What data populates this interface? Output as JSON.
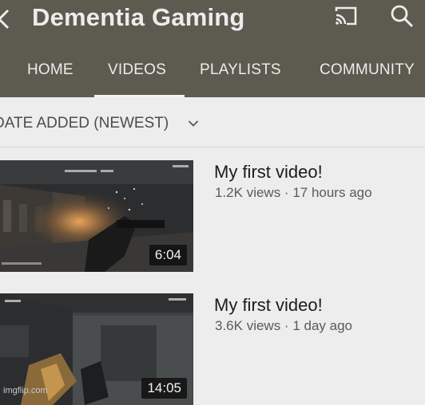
{
  "header": {
    "title": "Dementia Gaming",
    "icons": [
      "back-arrow-icon",
      "cast-icon",
      "search-icon"
    ]
  },
  "tabs": [
    {
      "label": "HOME",
      "selected": false
    },
    {
      "label": "VIDEOS",
      "selected": true
    },
    {
      "label": "PLAYLISTS",
      "selected": false
    },
    {
      "label": "COMMUNITY",
      "selected": false
    }
  ],
  "sort": {
    "label": "DATE ADDED (NEWEST)",
    "icon": "chevron-down-icon"
  },
  "videos": [
    {
      "title": "My first video!",
      "views": "1.2K views",
      "separator": " · ",
      "age": "17 hours ago",
      "duration": "6:04"
    },
    {
      "title": "My first video!",
      "views": "3.6K views",
      "separator": " · ",
      "age": "1 day ago",
      "duration": "14:05"
    }
  ],
  "watermark": "imgflip.com",
  "colors": {
    "header_bg": "#5d5a4f",
    "header_text": "#ececec",
    "page_bg": "#ededed",
    "title_text": "#1c1c1c",
    "meta_text": "#5a5a5a"
  }
}
